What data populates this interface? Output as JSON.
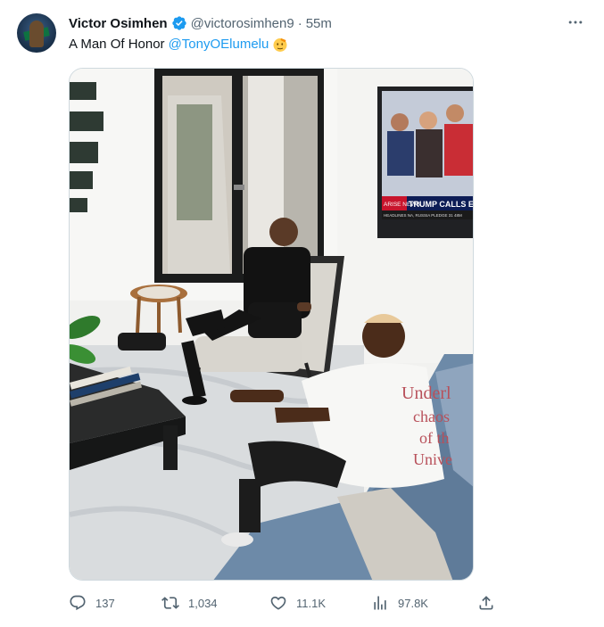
{
  "author": {
    "name": "Victor Osimhen",
    "handle": "@victorosimhen9",
    "separator": "·",
    "time": "55m"
  },
  "tweet": {
    "text": "A Man Of Honor",
    "mention": "@TonyOElumelu",
    "emoji": "saluting-face"
  },
  "media": {
    "tv": {
      "channel": "ARISE NEWS",
      "headline": "TRUMP CALLS E",
      "ticker": "HEADLINES NA, RUSSIA PLEDGE 31 48M"
    },
    "shirt_text": [
      "Underl",
      "chaos",
      "of th",
      "Unive"
    ]
  },
  "actions": {
    "replies": "137",
    "reposts": "1,034",
    "likes": "11.1K",
    "views": "97.8K"
  },
  "colors": {
    "link": "#1d9bf0",
    "muted": "#536471",
    "verified": "#1d9bf0"
  }
}
